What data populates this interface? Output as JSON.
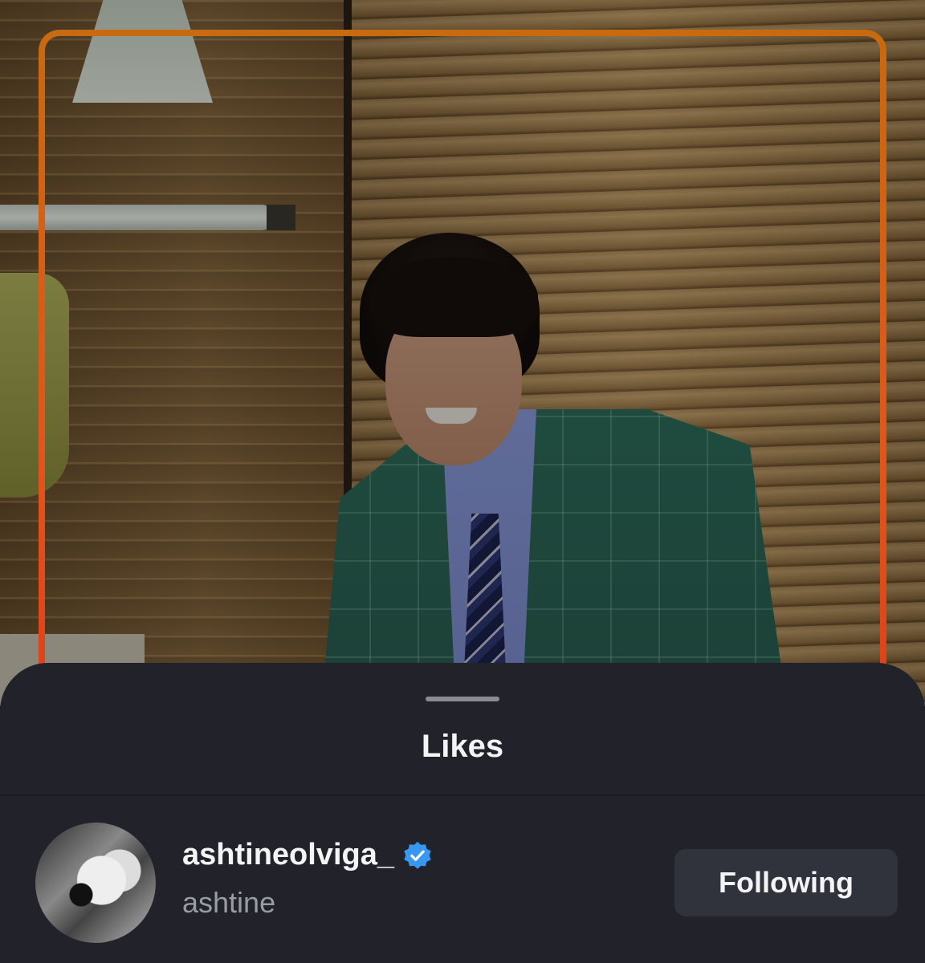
{
  "sheet": {
    "title": "Likes"
  },
  "likes": [
    {
      "username": "ashtineolviga_",
      "full_name": "ashtine",
      "verified": true,
      "button_label": "Following"
    }
  ],
  "colors": {
    "sheet_background": "#22232a",
    "button_background": "#31333c",
    "verified_badge": "#3897f0",
    "story_ring_top": "#c76a10",
    "story_ring_bottom": "#e03a1a"
  },
  "icons": {
    "verified": "verified-badge-icon"
  }
}
